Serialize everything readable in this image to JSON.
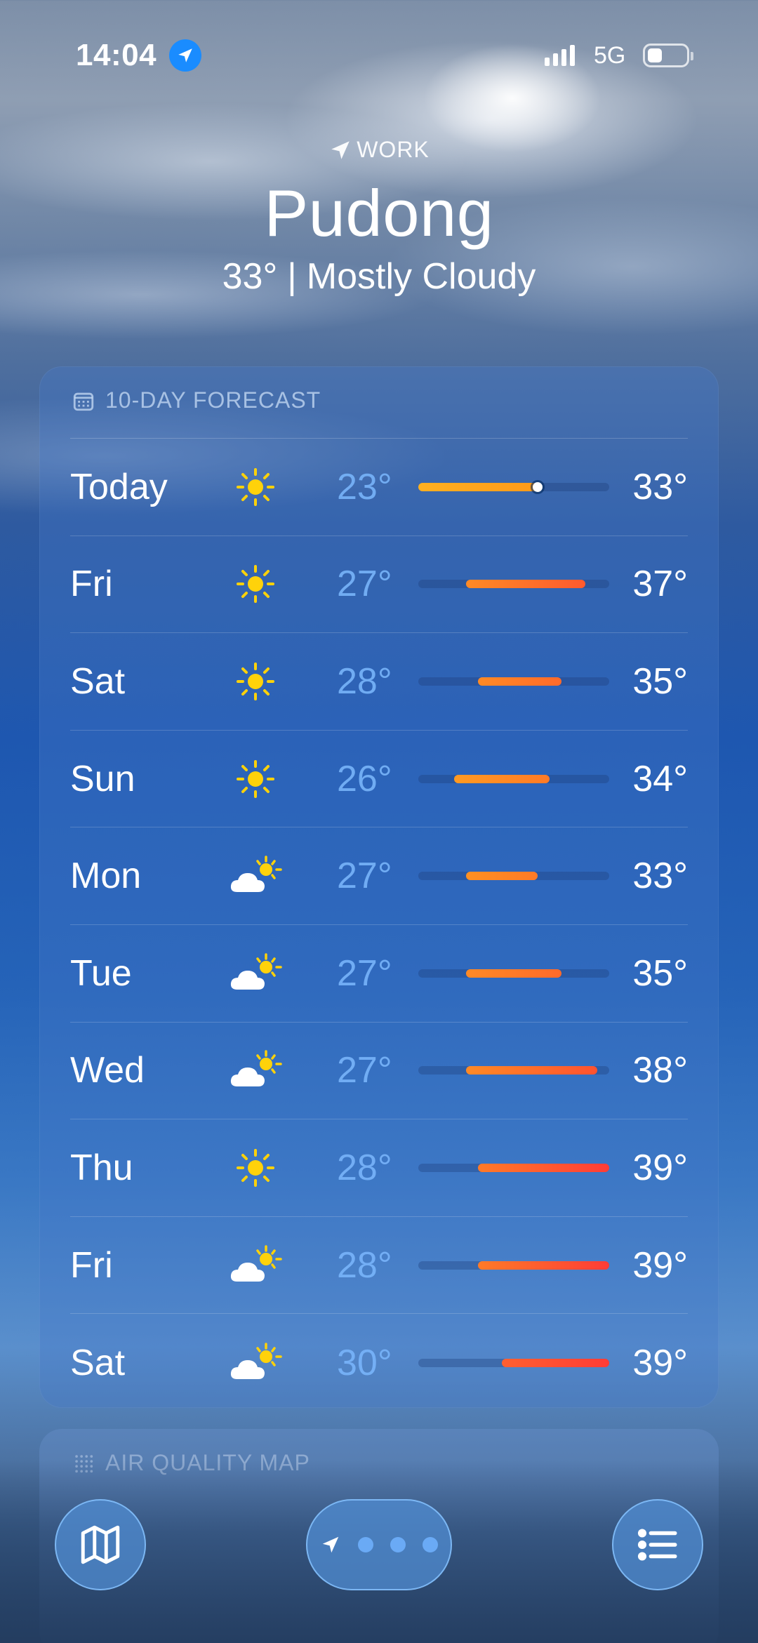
{
  "status_bar": {
    "time": "14:04",
    "network": "5G",
    "location_icon": "location-arrow-icon",
    "battery_icon": "battery-icon"
  },
  "header": {
    "location_label": "WORK",
    "city": "Pudong",
    "current_temp": "33°",
    "separator": "|",
    "condition": "Mostly Cloudy"
  },
  "forecast": {
    "title": "10-DAY FORECAST",
    "icon": "calendar-icon",
    "range_min": 23,
    "range_max": 39,
    "current_temp_value": 33,
    "days": [
      {
        "day": "Today",
        "icon": "sun",
        "low": "23°",
        "high": "33°",
        "low_value": 23,
        "high_value": 33,
        "color_from": "#ffb020",
        "color_to": "#ff9a1a",
        "current": true
      },
      {
        "day": "Fri",
        "icon": "sun",
        "low": "27°",
        "high": "37°",
        "low_value": 27,
        "high_value": 37,
        "color_from": "#ff8a25",
        "color_to": "#ff5a2e"
      },
      {
        "day": "Sat",
        "icon": "sun",
        "low": "28°",
        "high": "35°",
        "low_value": 28,
        "high_value": 35,
        "color_from": "#ff8a25",
        "color_to": "#ff6a2a"
      },
      {
        "day": "Sun",
        "icon": "sun",
        "low": "26°",
        "high": "34°",
        "low_value": 26,
        "high_value": 34,
        "color_from": "#ff9a22",
        "color_to": "#ff7a26"
      },
      {
        "day": "Mon",
        "icon": "partly-cloudy",
        "low": "27°",
        "high": "33°",
        "low_value": 27,
        "high_value": 33,
        "color_from": "#ff9022",
        "color_to": "#ff7a26"
      },
      {
        "day": "Tue",
        "icon": "partly-cloudy",
        "low": "27°",
        "high": "35°",
        "low_value": 27,
        "high_value": 35,
        "color_from": "#ff8a25",
        "color_to": "#ff6a2a"
      },
      {
        "day": "Wed",
        "icon": "partly-cloudy",
        "low": "27°",
        "high": "38°",
        "low_value": 27,
        "high_value": 38,
        "color_from": "#ff8a25",
        "color_to": "#ff5230"
      },
      {
        "day": "Thu",
        "icon": "sun",
        "low": "28°",
        "high": "39°",
        "low_value": 28,
        "high_value": 39,
        "color_from": "#ff7a28",
        "color_to": "#ff3c36"
      },
      {
        "day": "Fri",
        "icon": "partly-cloudy",
        "low": "28°",
        "high": "39°",
        "low_value": 28,
        "high_value": 39,
        "color_from": "#ff7a28",
        "color_to": "#ff3c36"
      },
      {
        "day": "Sat",
        "icon": "partly-cloudy",
        "low": "30°",
        "high": "39°",
        "low_value": 30,
        "high_value": 39,
        "color_from": "#ff6030",
        "color_to": "#ff3c36"
      }
    ]
  },
  "air_quality": {
    "title": "AIR QUALITY MAP",
    "icon": "air-quality-icon"
  },
  "toolbar": {
    "map_icon": "map-icon",
    "location_icon": "location-arrow-icon",
    "list_icon": "list-icon",
    "page_count": 3
  }
}
